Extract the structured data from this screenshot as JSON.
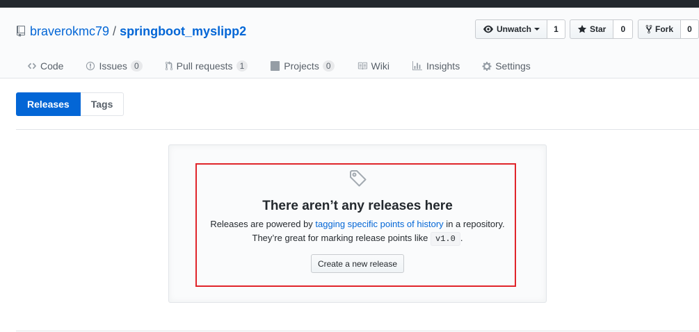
{
  "repo": {
    "owner": "braverokmc79",
    "separator": "/",
    "name": "springboot_myslipp2"
  },
  "actions": {
    "watch": {
      "label": "Unwatch",
      "count": "1"
    },
    "star": {
      "label": "Star",
      "count": "0"
    },
    "fork": {
      "label": "Fork",
      "count": "0"
    }
  },
  "nav": {
    "code": {
      "label": "Code"
    },
    "issues": {
      "label": "Issues",
      "count": "0"
    },
    "pulls": {
      "label": "Pull requests",
      "count": "1"
    },
    "projects": {
      "label": "Projects",
      "count": "0"
    },
    "wiki": {
      "label": "Wiki"
    },
    "insights": {
      "label": "Insights"
    },
    "settings": {
      "label": "Settings"
    }
  },
  "subnav": {
    "releases": "Releases",
    "tags": "Tags"
  },
  "blankslate": {
    "title": "There aren’t any releases here",
    "line1_prefix": "Releases are powered by ",
    "line1_link": "tagging specific points of history",
    "line1_suffix": " in a repository.",
    "line2_prefix": "They’re great for marking release points like ",
    "line2_code": "v1.0",
    "line2_suffix": ".",
    "button": "Create a new release"
  },
  "colors": {
    "link": "#0366d6",
    "selected_tab": "#0366d6",
    "highlight_border": "#e0242a",
    "topbar": "#24292e"
  }
}
